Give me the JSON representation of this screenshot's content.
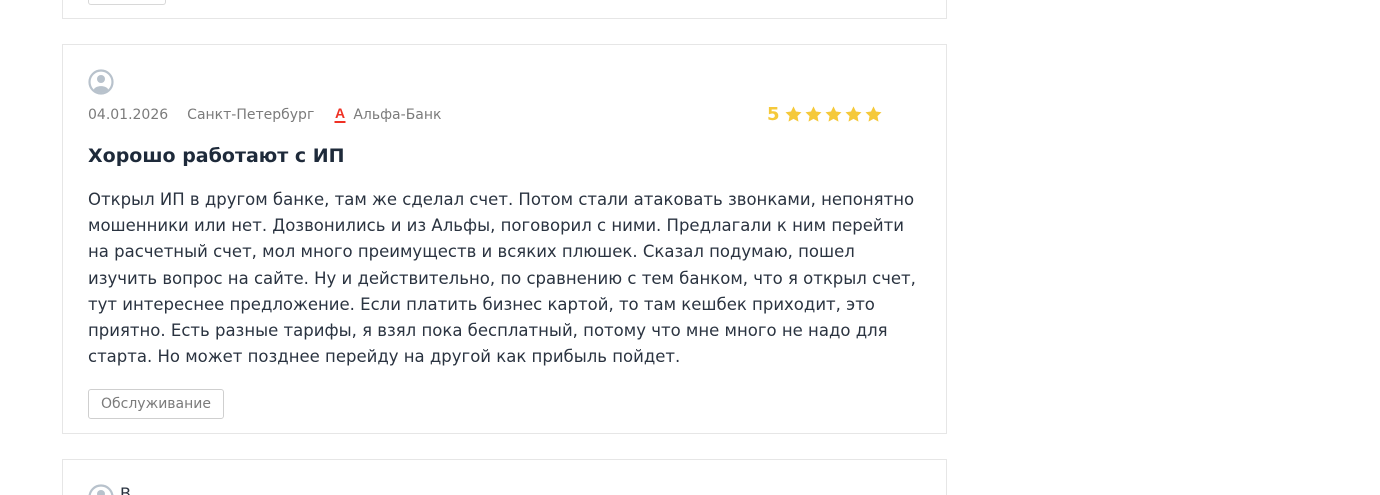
{
  "review": {
    "date": "04.01.2026",
    "city": "Санкт-Петербург",
    "bank_name": "Альфа-Банк",
    "bank_logo_letter": "А",
    "rating": "5",
    "stars": 5,
    "title": "Хорошо работают с ИП",
    "text": "Открыл ИП в другом банке, там же сделал счет. Потом стали атаковать звонками, непонятно мошенники или нет. Дозвонились и из Альфы, поговорил с ними. Предлагали к ним перейти на расчетный счет, мол много преимуществ и всяких плюшек. Сказал подумаю, пошел изучить вопрос на сайте. Ну и действительно, по сравнению с тем банком, что я открыл счет, тут интереснее предложение. Если платить бизнес картой, то там кешбек приходит, это приятно. Есть разные тарифы, я взял пока бесплатный, потому что мне много не надо для старта. Но может позднее перейду на другой как прибыль пойдет.",
    "tag": "Обслуживание"
  },
  "next_review": {
    "author_initial": "В"
  },
  "colors": {
    "star": "#f5c93a",
    "bank_logo": "#ef3124",
    "avatar": "#b8c2cc",
    "border": "#e6e6e6"
  },
  "icons": {
    "avatar": "user-avatar-icon",
    "star": "star-icon",
    "bank": "alfa-bank-logo-icon"
  }
}
